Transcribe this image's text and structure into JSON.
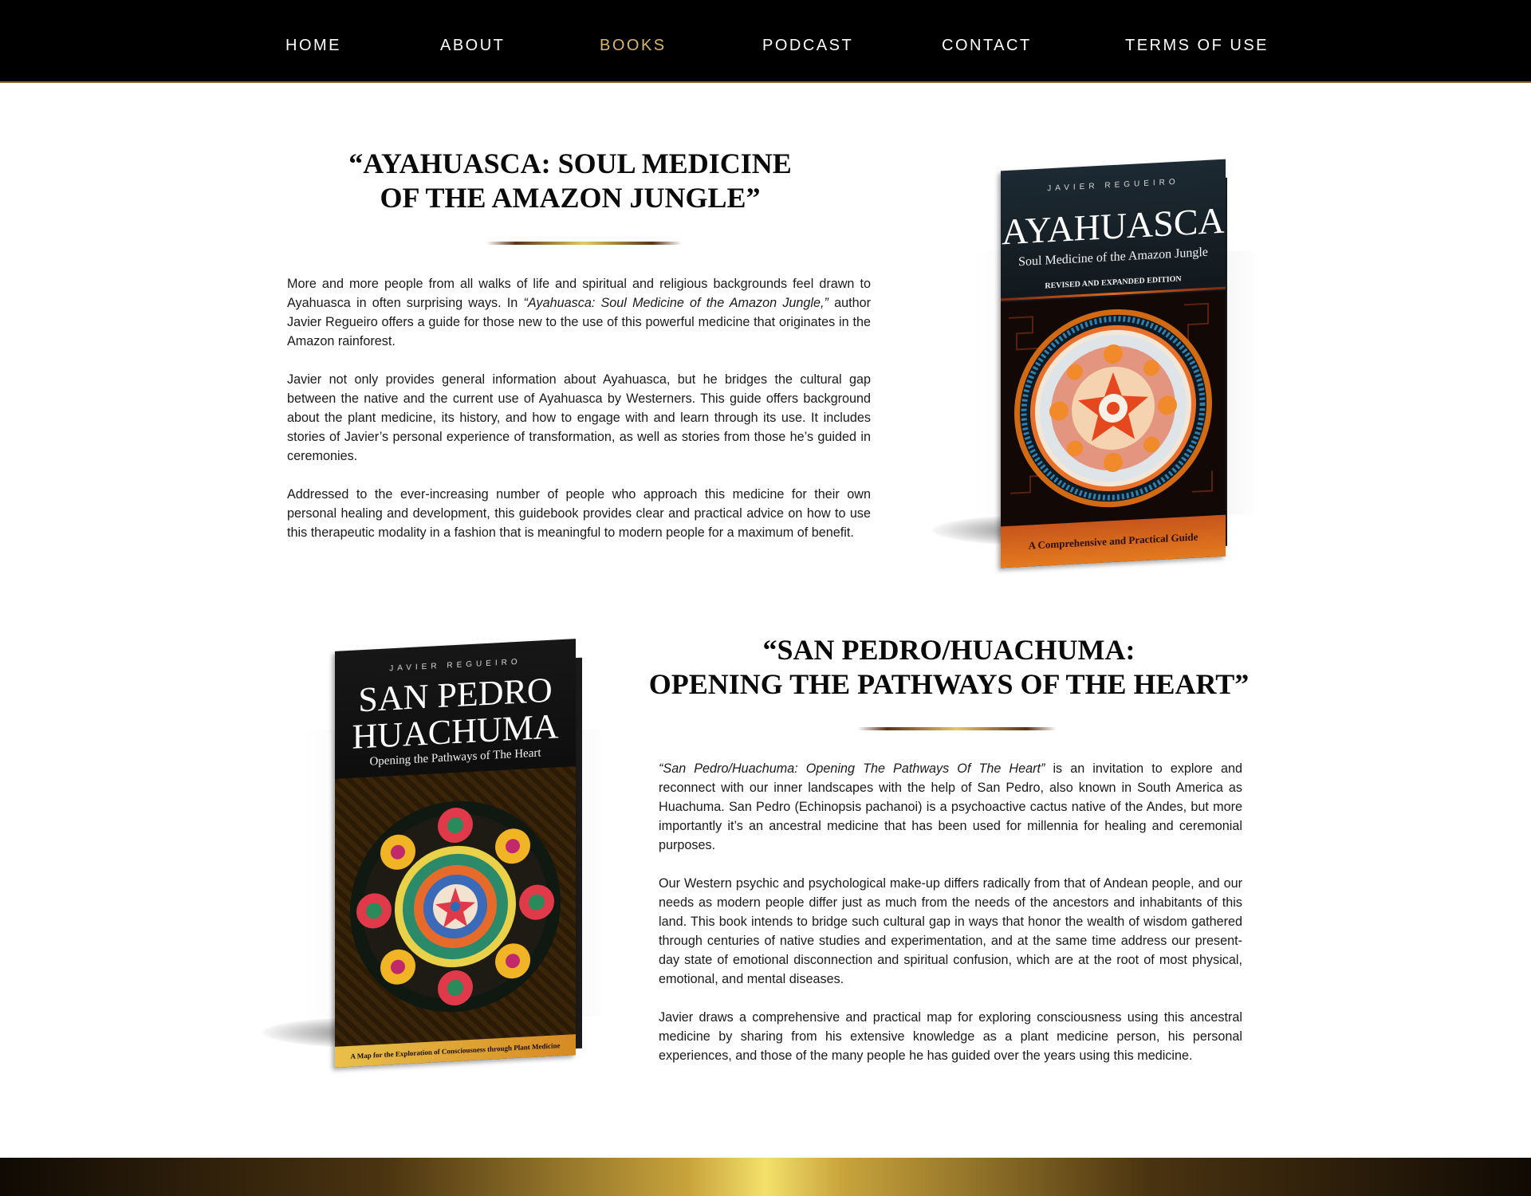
{
  "nav": {
    "items": [
      {
        "label": "HOME"
      },
      {
        "label": "ABOUT"
      },
      {
        "label": "BOOKS",
        "active": true
      },
      {
        "label": "PODCAST"
      },
      {
        "label": "CONTACT"
      },
      {
        "label": "TERMS OF USE"
      }
    ],
    "active_color": "#d9b56a"
  },
  "books": [
    {
      "title_line1": "“AYAHUASCA: SOUL MEDICINE",
      "title_line2": "OF THE AMAZON JUNGLE”",
      "paragraphs": [
        {
          "pre": "More and more people from all walks of life and spiritual and religious backgrounds feel drawn to Ayahuasca in often surprising ways. In ",
          "em": "“Ayahuasca: Soul Medicine of the Amazon Jungle,”",
          "post": " author Javier Regueiro offers a guide for those new to the use of this powerful medicine that originates in the Amazon rainforest."
        },
        {
          "text": "Javier not only provides general information about Ayahuasca, but he bridges the cultural gap between the native and the current use of Ayahuasca by Westerners. This guide offers background about the plant medicine, its history, and how to engage with and learn through its use. It includes stories of Javier’s personal experience of transformation, as well as stories from those he’s guided in ceremonies."
        },
        {
          "text": "Addressed to the ever-increasing number of people who approach this medicine for their own personal healing and development, this guidebook provides clear and practical advice on how to use this therapeutic modality in a fashion that is meaningful to modern people for a maximum of benefit."
        }
      ],
      "cover": {
        "author": "JAVIER REGUEIRO",
        "title": "AYAHUASCA",
        "subtitle": "Soul Medicine of the Amazon Jungle",
        "edition": "REVISED AND EXPANDED EDITION",
        "footer": "A Comprehensive and Practical Guide"
      }
    },
    {
      "title_line1": "“SAN PEDRO/HUACHUMA:",
      "title_line2": "OPENING THE PATHWAYS OF THE HEART”",
      "paragraphs": [
        {
          "em": "“San Pedro/Huachuma: Opening The Pathways Of The Heart”",
          "post": " is an invitation to explore and reconnect with our inner landscapes with the help of San Pedro, also known in South America as Huachuma. San Pedro (Echinopsis pachanoi) is a psychoactive cactus native of the Andes, but more importantly it’s an ancestral medicine that has been used for millennia for healing and ceremonial purposes."
        },
        {
          "text": "Our Western psychic and psychological make-up differs radically from that of Andean people, and our needs as modern people differ just as much from the needs of the ancestors and inhabitants of this land. This book intends to bridge such cultural gap in ways that honor the wealth of wisdom gathered through centuries of native studies and experimentation, and at the same time address our present-day state of emotional disconnection and spiritual confusion, which are at the root of most physical, emotional, and mental diseases."
        },
        {
          "text": "Javier draws a comprehensive and practical map for exploring consciousness using this ancestral medicine by sharing from his extensive knowledge as a plant medicine person, his personal experiences, and those of the many people he has guided over the years using this medicine."
        }
      ],
      "cover": {
        "author": "JAVIER REGUEIRO",
        "title_line1": "SAN PEDRO",
        "title_line2": "HUACHUMA",
        "subtitle": "Opening the Pathways of The Heart",
        "footer": "A Map for the Exploration of Consciousness through Plant Medicine"
      }
    }
  ]
}
